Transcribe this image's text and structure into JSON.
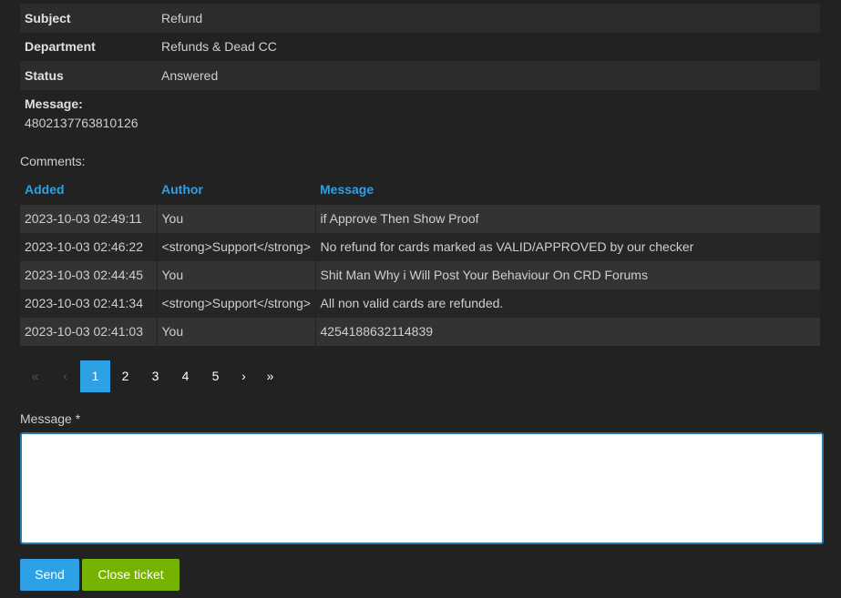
{
  "ticket": {
    "fields": [
      {
        "key": "Subject",
        "value": "Refund"
      },
      {
        "key": "Department",
        "value": "Refunds & Dead CC"
      },
      {
        "key": "Status",
        "value": "Answered"
      }
    ],
    "message_label": "Message:",
    "message_text": "4802137763810126"
  },
  "comments": {
    "label": "Comments:",
    "headers": {
      "added": "Added",
      "author": "Author",
      "message": "Message"
    },
    "rows": [
      {
        "added": "2023-10-03 02:49:11",
        "author": "You",
        "message": "if Approve Then Show Proof"
      },
      {
        "added": "2023-10-03 02:46:22",
        "author": "<strong>Support</strong>",
        "message": "No refund for cards marked as VALID/APPROVED by our checker"
      },
      {
        "added": "2023-10-03 02:44:45",
        "author": "You",
        "message": "Shit Man Why i Will Post Your Behaviour On CRD Forums"
      },
      {
        "added": "2023-10-03 02:41:34",
        "author": "<strong>Support</strong>",
        "message": "All non valid cards are refunded."
      },
      {
        "added": "2023-10-03 02:41:03",
        "author": "You",
        "message": "4254188632114839"
      }
    ]
  },
  "pagination": {
    "first": "«",
    "prev": "‹",
    "pages": [
      "1",
      "2",
      "3",
      "4",
      "5"
    ],
    "current": "1",
    "next": "›",
    "last": "»"
  },
  "form": {
    "message_label": "Message *",
    "message_value": "",
    "send_label": "Send",
    "close_label": "Close ticket"
  },
  "colors": {
    "background": "#222222",
    "link_blue": "#2ea1e4",
    "close_green": "#76b300"
  }
}
